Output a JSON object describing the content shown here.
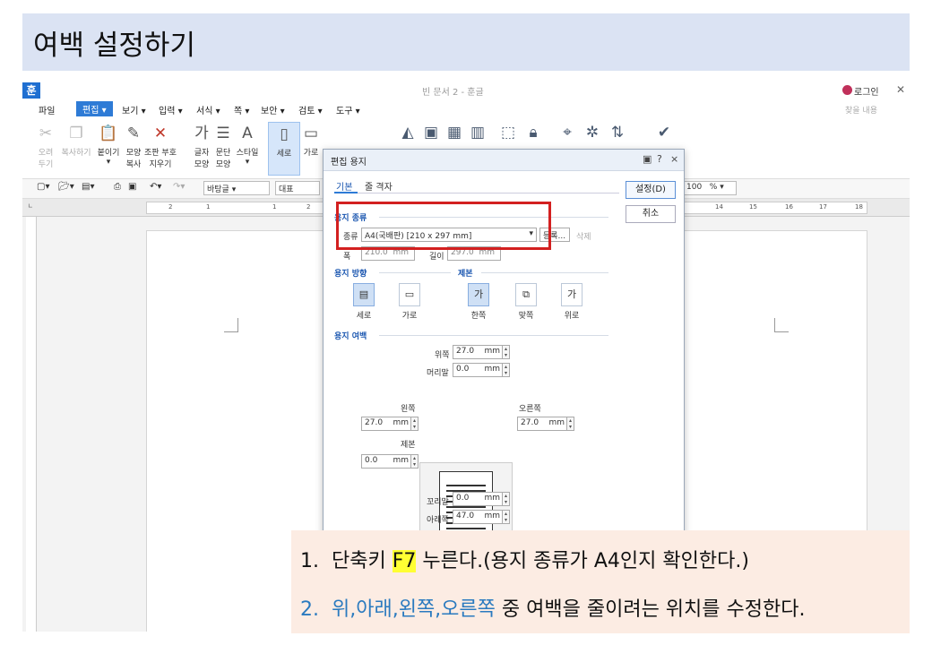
{
  "page_title": "여백 설정하기",
  "app": {
    "logo": "훈",
    "doc_title": "빈 문서 2 - 훈글",
    "login": "로그인",
    "close": "✕",
    "search_hint": "찾을 내용",
    "menus": [
      "파일",
      "편집 ▾",
      "보기 ▾",
      "입력 ▾",
      "서식 ▾",
      "쪽 ▾",
      "보안 ▾",
      "검토 ▾",
      "도구 ▾"
    ],
    "ribbon": {
      "cut": [
        "오려",
        "두기"
      ],
      "copy": [
        "복사하기",
        ""
      ],
      "paste": [
        "붙이기",
        "▾"
      ],
      "format_copy": [
        "모양",
        "복사"
      ],
      "clear": [
        "조판 부호",
        "지우기"
      ],
      "char": [
        "글자",
        "모양"
      ],
      "para": [
        "문단",
        "모양"
      ],
      "style": [
        "스타일",
        "▾"
      ],
      "portrait": [
        "세로",
        ""
      ],
      "landscape": [
        "가로",
        ""
      ]
    },
    "toolbar": {
      "font_style": "바탕글",
      "font_name": "대표",
      "zoom": "100",
      "zoom_unit": "%"
    },
    "ruler_marks": [
      "2",
      "1",
      "1",
      "2",
      "14",
      "15",
      "16",
      "17",
      "18"
    ]
  },
  "dialog": {
    "title": "편집 용지",
    "help": "?",
    "close": "×",
    "tabs": [
      "기본",
      "줄 격자"
    ],
    "buttons": {
      "ok": "설정(D)",
      "cancel": "취소"
    },
    "paper_section": "용지 종류",
    "type_label": "종류",
    "type_value": "A4(국배판) [210 x 297 mm]",
    "register": "등록...",
    "delete": "삭제",
    "width_label": "폭",
    "width_value": "210.0",
    "height_label": "길이",
    "height_value": "297.0",
    "unit": "mm",
    "orient_section": "용지 방향",
    "binding_section": "제본",
    "orient": [
      "세로",
      "가로"
    ],
    "binding": [
      "한쪽",
      "맞쪽",
      "위로"
    ],
    "margin_section": "용지 여백",
    "margins": {
      "top_label": "위쪽",
      "top": "27.0",
      "header_label": "머리말",
      "header": "0.0",
      "left_label": "왼쪽",
      "left": "27.0",
      "right_label": "오른쪽",
      "right": "27.0",
      "gutter_label": "제본",
      "gutter": "0.0",
      "footer_label": "꼬리말",
      "footer": "0.0",
      "bottom_label": "아래쪽",
      "bottom": "47.0"
    }
  },
  "instructions": {
    "step1_num": "1.",
    "step1_a": "단축키 ",
    "step1_key": "F7",
    "step1_b": " 누른다.(용지 종류가 A4인지 확인한다.)",
    "step2_num": "2.",
    "step2_a": "위,아래,왼쪽,오른쪽",
    "step2_b": " 중 여백을 줄이려는 위치를 수정한다."
  },
  "colors": {
    "accent": "#2e7bd6",
    "highlight_box": "#d32020",
    "banner": "#dbe3f3",
    "note_bg": "#fcece3",
    "key_highlight": "#ffff33"
  }
}
